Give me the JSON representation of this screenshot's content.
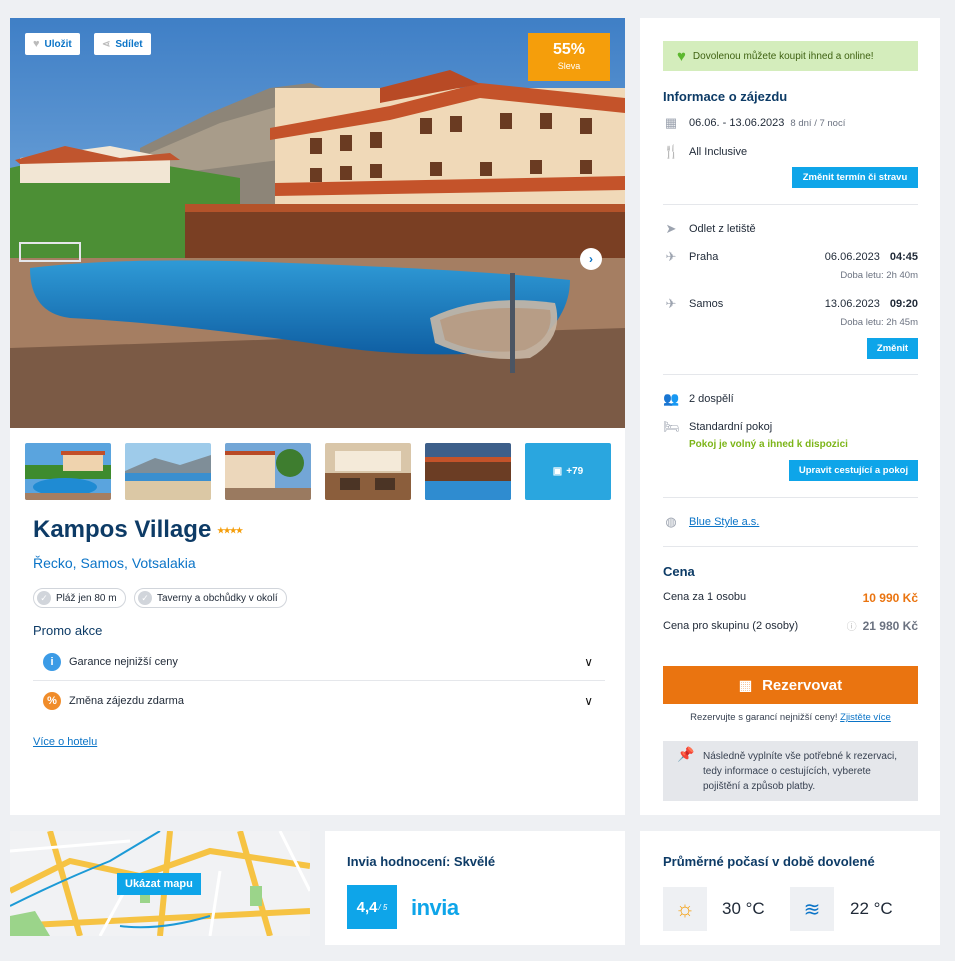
{
  "hero": {
    "save_label": "Uložit",
    "share_label": "Sdílet",
    "discount_value": "55%",
    "discount_label": "Sleva",
    "more_photos": "+79"
  },
  "hotel": {
    "name": "Kampos Village",
    "stars_display": "★★★★",
    "location": "Řecko, Samos, Votsalakia",
    "tags": [
      "Pláž jen 80 m",
      "Taverny a obchůdky v okolí"
    ],
    "promo_title": "Promo akce",
    "promos": [
      {
        "label": "Garance nejnižší ceny",
        "icon": "i",
        "color": "#3b9be6"
      },
      {
        "label": "Změna zájezdu zdarma",
        "icon": "%",
        "color": "#f08c2a"
      }
    ],
    "more_link": "Více o hotelu"
  },
  "side": {
    "online_banner": "Dovolenou můžete koupit ihned a online!",
    "trip_title": "Informace o zájezdu",
    "dates": "06.06. - 13.06.2023",
    "duration": "8 dní / 7 nocí",
    "board": "All Inclusive",
    "change_term_btn": "Změnit termín či stravu",
    "departure_title": "Odlet z letiště",
    "outbound": {
      "place": "Praha",
      "date": "06.06.2023",
      "time": "04:45",
      "flight": "Doba letu: 2h 40m"
    },
    "inbound": {
      "place": "Samos",
      "date": "13.06.2023",
      "time": "09:20",
      "flight": "Doba letu: 2h 45m"
    },
    "change_flight_btn": "Změnit",
    "travellers": "2 dospělí",
    "room": "Standardní pokoj",
    "room_status": "Pokoj je volný a ihned k dispozici",
    "edit_travellers_btn": "Upravit cestující a pokoj",
    "agency": "Blue Style a.s.",
    "price_title": "Cena",
    "price_person_label": "Cena za 1 osobu",
    "price_person": "10 990 Kč",
    "price_group_label": "Cena pro skupinu (2 osoby)",
    "price_group": "21 980 Kč",
    "reserve_btn": "Rezervovat",
    "guarantee_text": "Rezervujte s garancí nejnižší ceny!",
    "guarantee_link": "Zjistěte více",
    "info_text": "Následně vyplníte vše potřebné k rezervaci, tedy informace o cestujících, vyberete pojištění a způsob platby."
  },
  "map": {
    "button": "Ukázat mapu"
  },
  "rating": {
    "title": "Invia hodnocení: Skvělé",
    "score": "4,4",
    "scale": "/ 5",
    "brand": "invia"
  },
  "weather": {
    "title": "Průměrné počasí v době dovolené",
    "air_temp": "30 °C",
    "water_temp": "22 °C"
  },
  "colors": {
    "accent": "#0ea5e9",
    "reserve": "#ea7410",
    "discount": "#f59e0b",
    "title": "#0d3b66",
    "green": "#7cb518"
  }
}
